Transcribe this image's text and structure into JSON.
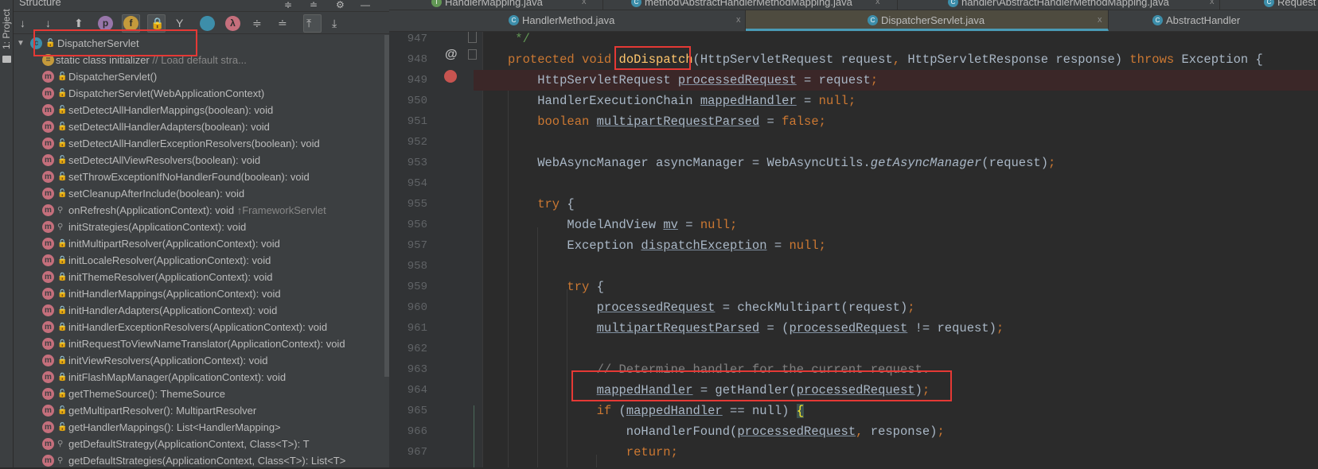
{
  "sidebar_strip": {
    "label": "1: Project"
  },
  "structure": {
    "title": "Structure",
    "toolbar": [
      {
        "icon": "sort-by-visibility-icon"
      },
      {
        "icon": "sort-alphabetically-icon"
      },
      {
        "icon": "show-inherited-icon"
      },
      {
        "icon": "show-properties-icon",
        "glyph": "p",
        "color": "#9876aa"
      },
      {
        "icon": "show-fields-icon",
        "glyph": "f",
        "color": "#c49a3c"
      },
      {
        "icon": "show-non-public-icon"
      },
      {
        "icon": "show-lambdas-tree-icon"
      },
      {
        "icon": "show-anonymous-icon",
        "color": "#3d8eaa"
      },
      {
        "icon": "show-lambdas-icon",
        "glyph": "λ",
        "color": "#c56f7c"
      },
      {
        "icon": "expand-all-icon"
      },
      {
        "icon": "collapse-all-icon"
      },
      {
        "icon": "autoscroll-to-source-icon"
      },
      {
        "icon": "autoscroll-from-source-icon"
      }
    ],
    "root": {
      "label": "DispatcherServlet",
      "access": "public"
    },
    "items": [
      {
        "label": "static class initializer",
        "comment": "// Load default stra...",
        "kind": "init",
        "access": ""
      },
      {
        "label": "DispatcherServlet()",
        "kind": "method",
        "access": "public"
      },
      {
        "label": "DispatcherServlet(WebApplicationContext)",
        "kind": "method",
        "access": "public"
      },
      {
        "label": "setDetectAllHandlerMappings(boolean): void",
        "kind": "method",
        "access": "public"
      },
      {
        "label": "setDetectAllHandlerAdapters(boolean): void",
        "kind": "method",
        "access": "public"
      },
      {
        "label": "setDetectAllHandlerExceptionResolvers(boolean): void",
        "kind": "method",
        "access": "public"
      },
      {
        "label": "setDetectAllViewResolvers(boolean): void",
        "kind": "method",
        "access": "public"
      },
      {
        "label": "setThrowExceptionIfNoHandlerFound(boolean): void",
        "kind": "method",
        "access": "public"
      },
      {
        "label": "setCleanupAfterInclude(boolean): void",
        "kind": "method",
        "access": "public"
      },
      {
        "label": "onRefresh(ApplicationContext): void",
        "suffix": "↑FrameworkServlet",
        "kind": "method",
        "access": "protected"
      },
      {
        "label": "initStrategies(ApplicationContext): void",
        "kind": "method",
        "access": "protected"
      },
      {
        "label": "initMultipartResolver(ApplicationContext): void",
        "kind": "method",
        "access": "private"
      },
      {
        "label": "initLocaleResolver(ApplicationContext): void",
        "kind": "method",
        "access": "private"
      },
      {
        "label": "initThemeResolver(ApplicationContext): void",
        "kind": "method",
        "access": "private"
      },
      {
        "label": "initHandlerMappings(ApplicationContext): void",
        "kind": "method",
        "access": "private"
      },
      {
        "label": "initHandlerAdapters(ApplicationContext): void",
        "kind": "method",
        "access": "private"
      },
      {
        "label": "initHandlerExceptionResolvers(ApplicationContext): void",
        "kind": "method",
        "access": "private"
      },
      {
        "label": "initRequestToViewNameTranslator(ApplicationContext): void",
        "kind": "method",
        "access": "private"
      },
      {
        "label": "initViewResolvers(ApplicationContext): void",
        "kind": "method",
        "access": "private"
      },
      {
        "label": "initFlashMapManager(ApplicationContext): void",
        "kind": "method",
        "access": "private"
      },
      {
        "label": "getThemeSource(): ThemeSource",
        "kind": "method",
        "access": "public"
      },
      {
        "label": "getMultipartResolver(): MultipartResolver",
        "kind": "method",
        "access": "public"
      },
      {
        "label": "getHandlerMappings(): List<HandlerMapping>",
        "kind": "method",
        "access": "public"
      },
      {
        "label": "getDefaultStrategy(ApplicationContext, Class<T>): T",
        "kind": "method",
        "access": "protected"
      },
      {
        "label": "getDefaultStrategies(ApplicationContext, Class<T>): List<T>",
        "kind": "method",
        "access": "protected"
      }
    ]
  },
  "tabs_row1": [
    {
      "label": "HandlerMapping.java",
      "icon": "interface-icon"
    },
    {
      "label": "method\\AbstractHandlerMethodMapping.java",
      "icon": "class-icon"
    },
    {
      "label": "handler\\AbstractHandlerMethodMapping.java",
      "icon": "class-icon"
    },
    {
      "label": "Request",
      "icon": "class-icon"
    }
  ],
  "tabs_row2": [
    {
      "label": "HandlerMethod.java",
      "icon": "class-icon"
    },
    {
      "label": "DispatcherServlet.java",
      "icon": "class-icon",
      "active": true
    },
    {
      "label": "AbstractHandler",
      "icon": "class-icon"
    }
  ],
  "close_glyph": "x",
  "colors": {
    "keyword": "#cc7832",
    "method_decl": "#ffc66d",
    "text": "#a9b7c6",
    "highlight_box": "#e53935",
    "breakpoint": "#c75450"
  },
  "editor": {
    "lines": [
      {
        "n": "947",
        "tokens": [
          [
            " */",
            "g"
          ]
        ],
        "indent": 0
      },
      {
        "n": "948",
        "tokens": [
          [
            "protected void ",
            "k"
          ],
          [
            "doDispatch",
            "f"
          ],
          [
            "(HttpServletRequest request",
            ""
          ],
          [
            ", ",
            "k"
          ],
          [
            "HttpServletResponse response) ",
            ""
          ],
          [
            "throws ",
            "k"
          ],
          [
            "Exception {",
            ""
          ]
        ],
        "indent": 0
      },
      {
        "n": "949",
        "tokens": [
          [
            "HttpServletRequest ",
            ""
          ],
          [
            "processedRequest",
            "u"
          ],
          [
            " = request",
            ""
          ],
          [
            ";",
            "k"
          ]
        ],
        "indent": 1,
        "breakpoint": true
      },
      {
        "n": "950",
        "tokens": [
          [
            "HandlerExecutionChain ",
            ""
          ],
          [
            "mappedHandler",
            "u"
          ],
          [
            " = ",
            ""
          ],
          [
            "null;",
            "k"
          ]
        ],
        "indent": 1
      },
      {
        "n": "951",
        "tokens": [
          [
            "boolean ",
            "k"
          ],
          [
            "multipartRequestParsed",
            "u"
          ],
          [
            " = ",
            ""
          ],
          [
            "false;",
            "k"
          ]
        ],
        "indent": 1
      },
      {
        "n": "952",
        "tokens": [],
        "indent": 1
      },
      {
        "n": "953",
        "tokens": [
          [
            "WebAsyncManager asyncManager = WebAsyncUtils.",
            ""
          ],
          [
            "getAsyncManager",
            "i"
          ],
          [
            "(request)",
            ""
          ],
          [
            ";",
            "k"
          ]
        ],
        "indent": 1
      },
      {
        "n": "954",
        "tokens": [],
        "indent": 1
      },
      {
        "n": "955",
        "tokens": [
          [
            "try ",
            "k"
          ],
          [
            "{",
            ""
          ]
        ],
        "indent": 1
      },
      {
        "n": "956",
        "tokens": [
          [
            "ModelAndView ",
            ""
          ],
          [
            "mv",
            "u"
          ],
          [
            " = ",
            ""
          ],
          [
            "null;",
            "k"
          ]
        ],
        "indent": 2
      },
      {
        "n": "957",
        "tokens": [
          [
            "Exception ",
            ""
          ],
          [
            "dispatchException",
            "u"
          ],
          [
            " = ",
            ""
          ],
          [
            "null;",
            "k"
          ]
        ],
        "indent": 2
      },
      {
        "n": "958",
        "tokens": [],
        "indent": 2
      },
      {
        "n": "959",
        "tokens": [
          [
            "try ",
            "k"
          ],
          [
            "{",
            ""
          ]
        ],
        "indent": 2
      },
      {
        "n": "960",
        "tokens": [
          [
            "processedRequest",
            "u"
          ],
          [
            " = checkMultipart(request)",
            ""
          ],
          [
            ";",
            "k"
          ]
        ],
        "indent": 3
      },
      {
        "n": "961",
        "tokens": [
          [
            "multipartRequestParsed",
            "u"
          ],
          [
            " = (",
            ""
          ],
          [
            "processedRequest",
            "u"
          ],
          [
            " != request)",
            ""
          ],
          [
            ";",
            "k"
          ]
        ],
        "indent": 3
      },
      {
        "n": "962",
        "tokens": [],
        "indent": 3
      },
      {
        "n": "963",
        "tokens": [
          [
            "// Determine handler for the current request.",
            "c2"
          ]
        ],
        "indent": 3
      },
      {
        "n": "964",
        "tokens": [
          [
            "mappedHandler",
            "u"
          ],
          [
            " = getHandler(",
            ""
          ],
          [
            "processedRequest",
            "u"
          ],
          [
            ")",
            ""
          ],
          [
            ";",
            "k"
          ]
        ],
        "indent": 3
      },
      {
        "n": "965",
        "tokens": [
          [
            "if ",
            "k"
          ],
          [
            "(",
            ""
          ],
          [
            "mappedHandler",
            "u"
          ],
          [
            " == ",
            ""
          ],
          [
            "null",
            ""
          ],
          [
            ") ",
            ""
          ],
          [
            "{",
            "brace"
          ]
        ],
        "indent": 3
      },
      {
        "n": "966",
        "tokens": [
          [
            "noHandlerFound(",
            ""
          ],
          [
            "processedRequest",
            "u"
          ],
          [
            ", ",
            "k"
          ],
          [
            "response)",
            ""
          ],
          [
            ";",
            "k"
          ]
        ],
        "indent": 4
      },
      {
        "n": "967",
        "tokens": [
          [
            "return;",
            "k"
          ]
        ],
        "indent": 4
      }
    ]
  }
}
